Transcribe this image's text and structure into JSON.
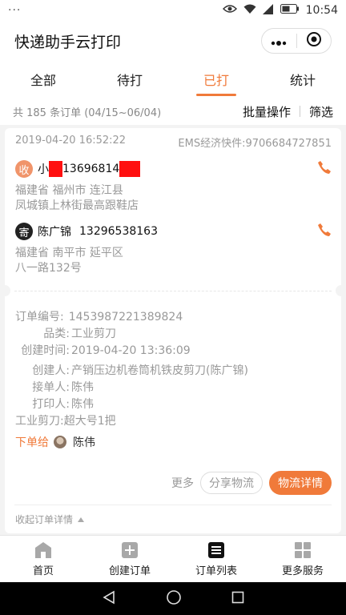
{
  "status_bar": {
    "time": "10:54",
    "left_dots": "···"
  },
  "app": {
    "title": "快递助手云打印"
  },
  "tabs": [
    {
      "label": "全部",
      "active": false
    },
    {
      "label": "待打",
      "active": false
    },
    {
      "label": "已打",
      "active": true
    },
    {
      "label": "统计",
      "active": false
    }
  ],
  "summary": {
    "count_text": "共 185 条订单 (04/15~06/04)",
    "batch_label": "批量操作",
    "filter_label": "筛选"
  },
  "order": {
    "printed_at": "2019-04-20 16:52:22",
    "express": "EMS经济快件:9706684727851",
    "receiver": {
      "badge": "收",
      "name_prefix": "小",
      "phone_prefix": "13696814",
      "address_line1": "福建省 福州市 连江县",
      "address_line2": "凤城镇上林街最高跟鞋店"
    },
    "sender": {
      "badge": "寄",
      "name": "陈广锦",
      "phone": "13296538163",
      "address_line1": "福建省 南平市 延平区",
      "address_line2": "八一路132号"
    },
    "details": [
      {
        "key": "订单编号:",
        "value": "1453987221389824"
      },
      {
        "key": "品类:",
        "value": "工业剪刀"
      },
      {
        "key": "创建时间:",
        "value": "2019-04-20 13:36:09"
      },
      {
        "key": "创建人:",
        "value": "产销压边机卷筒机铁皮剪刀(陈广锦)"
      },
      {
        "key": "接单人:",
        "value": "陈伟"
      },
      {
        "key": "打印人:",
        "value": "陈伟"
      }
    ],
    "item_line": "工业剪刀:超大号1把",
    "assign_label": "下单给",
    "assign_name": "陈伟",
    "more_label": "更多",
    "share_label": "分享物流",
    "logistics_label": "物流详情",
    "collapse_label": "收起订单详情"
  },
  "bottom_nav": [
    {
      "label": "首页",
      "icon": "home-icon"
    },
    {
      "label": "创建订单",
      "icon": "plus-square-icon"
    },
    {
      "label": "订单列表",
      "icon": "list-icon"
    },
    {
      "label": "更多服务",
      "icon": "grid-icon"
    }
  ],
  "colors": {
    "accent": "#f07a3a",
    "receiver_badge": "#f0946a",
    "redaction": "#ff1010"
  }
}
